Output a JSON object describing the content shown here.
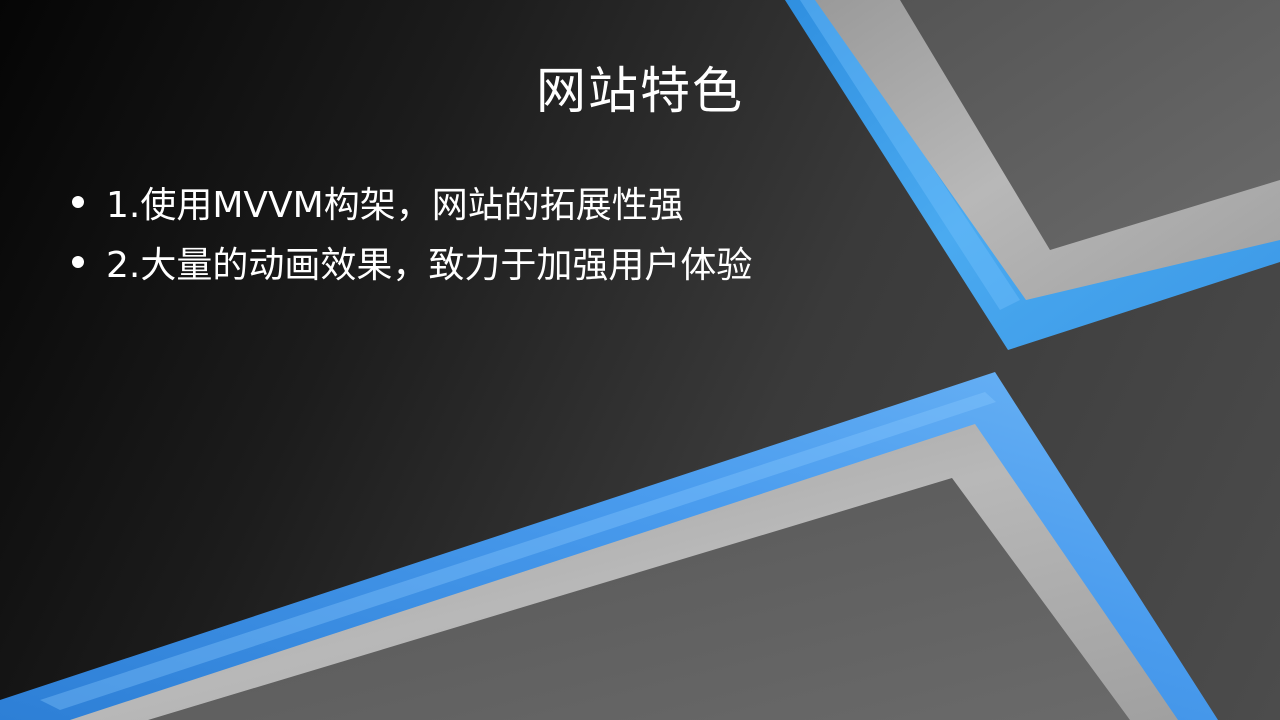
{
  "slide": {
    "title": "网站特色",
    "bullets": [
      "1.使用MVVM构架，网站的拓展性强",
      "2.大量的动画效果，致力于加强用户体验"
    ]
  },
  "colors": {
    "background_dark": "#050505",
    "background_light": "#4c4c4c",
    "frame_blue": "#3a9be6",
    "frame_silver": "#a8a8a8",
    "panel_gray": "#5c5c5c",
    "text": "#ffffff"
  }
}
